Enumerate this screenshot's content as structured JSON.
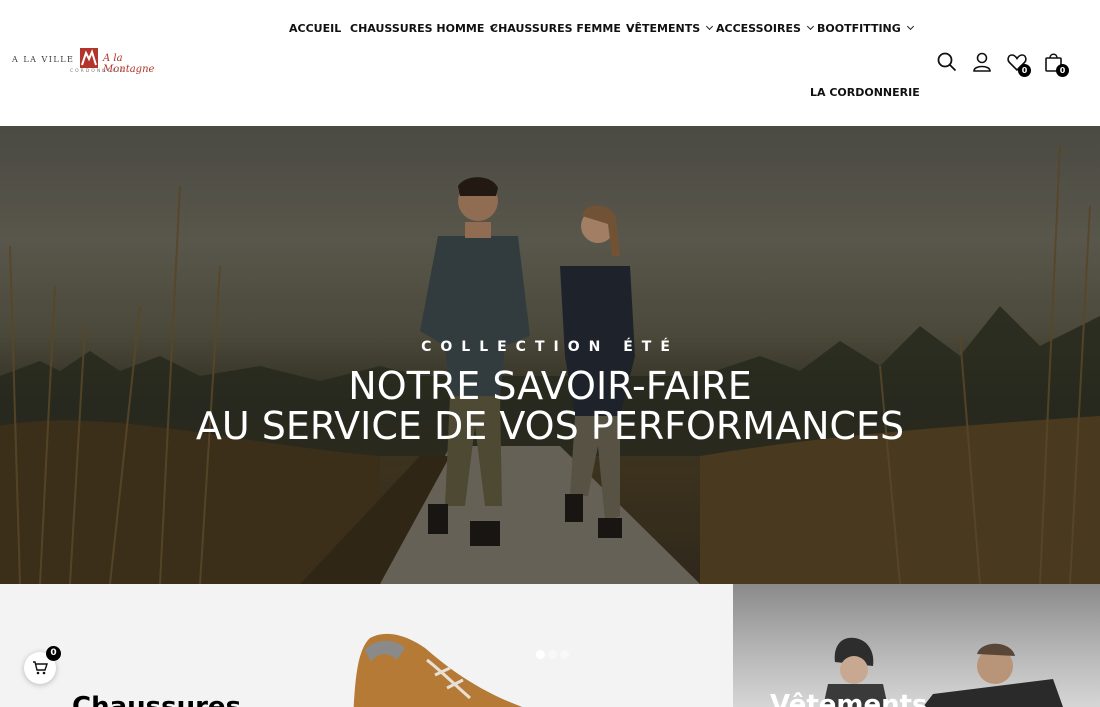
{
  "brand": {
    "left_text": "A LA VILLE",
    "right_text": "A la Montagne",
    "sub_text": "CORDONNERIE",
    "color": "#b3342a"
  },
  "nav": {
    "items": [
      {
        "label": "ACCUEIL",
        "has_dropdown": false
      },
      {
        "label": "CHAUSSURES HOMME",
        "has_dropdown": true
      },
      {
        "label": "CHAUSSURES FEMME",
        "has_dropdown": true
      },
      {
        "label": "VÊTEMENTS",
        "has_dropdown": true
      },
      {
        "label": "ACCESSOIRES",
        "has_dropdown": true
      },
      {
        "label": "BOOTFITTING",
        "has_dropdown": true
      }
    ],
    "second_row": "LA CORDONNERIE"
  },
  "header_icons": {
    "search": "search-icon",
    "account": "user-icon",
    "wishlist": {
      "icon": "heart-icon",
      "count": "0"
    },
    "cart": {
      "icon": "shopping-bag-icon",
      "count": "0"
    }
  },
  "hero": {
    "eyebrow": "COLLECTION ÉTÉ",
    "title_line1": "NOTRE SAVOIR-FAIRE",
    "title_line2": "AU SERVICE DE VOS PERFORMANCES"
  },
  "categories": {
    "left_title": "Chaussures",
    "right_title": "Vêtements"
  },
  "floating_cart": {
    "icon": "cart-icon",
    "count": "0"
  }
}
